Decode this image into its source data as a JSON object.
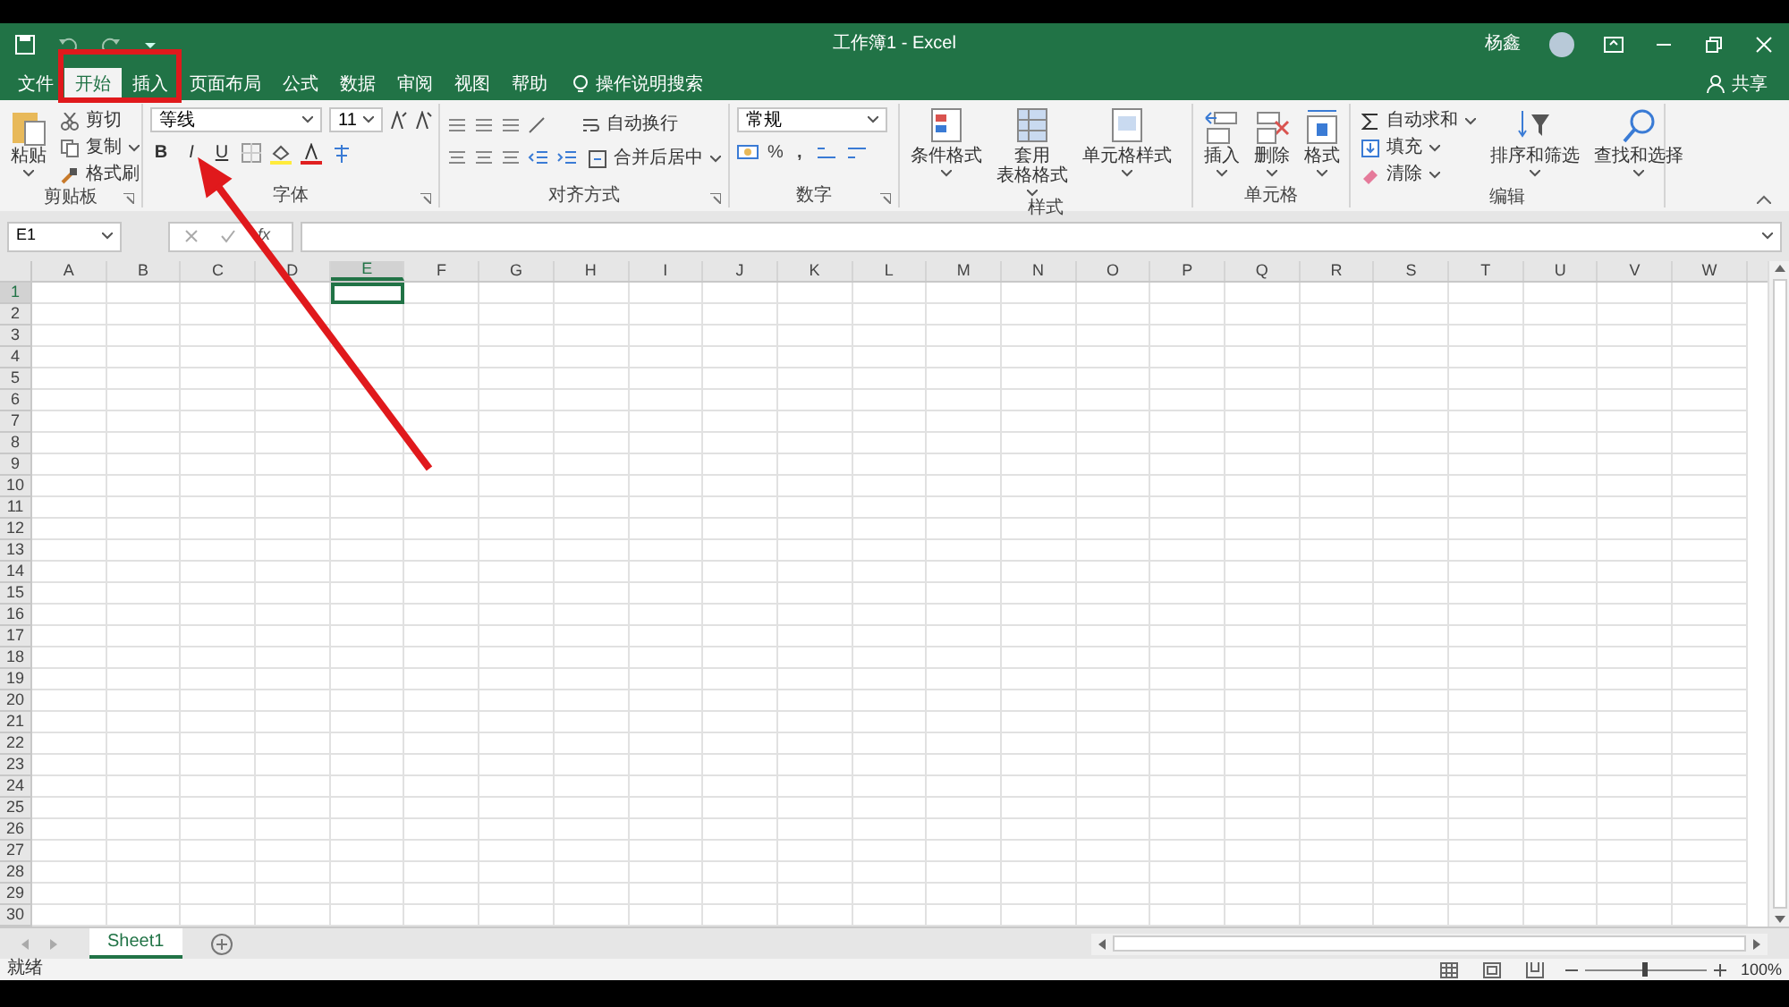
{
  "window": {
    "title": "工作簿1 - Excel",
    "user": "杨鑫"
  },
  "tabs": [
    {
      "label": "文件",
      "selected": false
    },
    {
      "label": "开始",
      "selected": true
    },
    {
      "label": "插入",
      "selected": false
    },
    {
      "label": "页面布局",
      "selected": false
    },
    {
      "label": "公式",
      "selected": false
    },
    {
      "label": "数据",
      "selected": false
    },
    {
      "label": "审阅",
      "selected": false
    },
    {
      "label": "视图",
      "selected": false
    },
    {
      "label": "帮助",
      "selected": false
    }
  ],
  "tell_me": "操作说明搜索",
  "share": "共享",
  "ribbon": {
    "clipboard": {
      "label": "剪贴板",
      "paste": "粘贴",
      "cut": "剪切",
      "copy": "复制",
      "format_painter": "格式刷"
    },
    "font": {
      "label": "字体",
      "font_name": "等线",
      "font_size": "11",
      "bold": "B",
      "italic": "I",
      "underline": "U"
    },
    "alignment": {
      "label": "对齐方式",
      "wrap": "自动换行",
      "merge": "合并后居中"
    },
    "number": {
      "label": "数字",
      "format": "常规",
      "percent": "%",
      "comma": ","
    },
    "styles": {
      "label": "样式",
      "conditional": "条件格式",
      "table": [
        "套用",
        "表格格式"
      ],
      "cell_styles": "单元格样式"
    },
    "cells": {
      "label": "单元格",
      "insert": "插入",
      "delete": "删除",
      "format": "格式"
    },
    "editing": {
      "label": "编辑",
      "autosum": "自动求和",
      "fill": "填充",
      "clear": "清除",
      "sort": "排序和筛选",
      "find": "查找和选择"
    }
  },
  "formula_bar": {
    "name_box": "E1",
    "fx": "fx"
  },
  "sheet": {
    "columns": [
      {
        "label": "A",
        "selected": false
      },
      {
        "label": "B",
        "selected": false
      },
      {
        "label": "C",
        "selected": false
      },
      {
        "label": "D",
        "selected": false
      },
      {
        "label": "E",
        "selected": true
      },
      {
        "label": "F",
        "selected": false
      },
      {
        "label": "G",
        "selected": false
      },
      {
        "label": "H",
        "selected": false
      },
      {
        "label": "I",
        "selected": false
      },
      {
        "label": "J",
        "selected": false
      },
      {
        "label": "K",
        "selected": false
      },
      {
        "label": "L",
        "selected": false
      },
      {
        "label": "M",
        "selected": false
      },
      {
        "label": "N",
        "selected": false
      },
      {
        "label": "O",
        "selected": false
      },
      {
        "label": "P",
        "selected": false
      },
      {
        "label": "Q",
        "selected": false
      },
      {
        "label": "R",
        "selected": false
      },
      {
        "label": "S",
        "selected": false
      },
      {
        "label": "T",
        "selected": false
      },
      {
        "label": "U",
        "selected": false
      },
      {
        "label": "V",
        "selected": false
      },
      {
        "label": "W",
        "selected": false
      }
    ],
    "rows": [
      {
        "label": "1",
        "selected": true
      },
      {
        "label": "2",
        "selected": false
      },
      {
        "label": "3",
        "selected": false
      },
      {
        "label": "4",
        "selected": false
      },
      {
        "label": "5",
        "selected": false
      },
      {
        "label": "6",
        "selected": false
      },
      {
        "label": "7",
        "selected": false
      },
      {
        "label": "8",
        "selected": false
      },
      {
        "label": "9",
        "selected": false
      },
      {
        "label": "10",
        "selected": false
      },
      {
        "label": "11",
        "selected": false
      },
      {
        "label": "12",
        "selected": false
      },
      {
        "label": "13",
        "selected": false
      },
      {
        "label": "14",
        "selected": false
      },
      {
        "label": "15",
        "selected": false
      },
      {
        "label": "16",
        "selected": false
      },
      {
        "label": "17",
        "selected": false
      },
      {
        "label": "18",
        "selected": false
      },
      {
        "label": "19",
        "selected": false
      },
      {
        "label": "20",
        "selected": false
      },
      {
        "label": "21",
        "selected": false
      },
      {
        "label": "22",
        "selected": false
      },
      {
        "label": "23",
        "selected": false
      },
      {
        "label": "24",
        "selected": false
      },
      {
        "label": "25",
        "selected": false
      },
      {
        "label": "26",
        "selected": false
      },
      {
        "label": "27",
        "selected": false
      },
      {
        "label": "28",
        "selected": false
      },
      {
        "label": "29",
        "selected": false
      },
      {
        "label": "30",
        "selected": false
      }
    ]
  },
  "sheet_tabs": [
    {
      "label": "Sheet1",
      "selected": true
    }
  ],
  "status_bar": {
    "status": "就绪",
    "zoom": "100%",
    "zoom_slider": {
      "level": 0.5
    }
  }
}
